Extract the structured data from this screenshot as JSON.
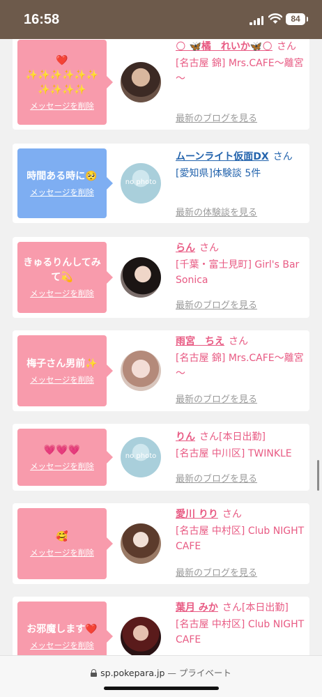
{
  "status_bar": {
    "time": "16:58",
    "battery": "84"
  },
  "cards": [
    {
      "bubble_text": "❤️\n✨✨✨✨✨✨\n✨✨✨✨",
      "bubble_color": "#f89bac",
      "delete_label": "メッセージを削除",
      "name": "🌕 🦋橘　れいか🦋🌕",
      "san": "さん",
      "extra": "",
      "location": "[名古屋 錦] Mrs.CAFE～離宮～",
      "link": "最新のブログを見る",
      "name_color": "#e85a83"
    },
    {
      "bubble_text": "時間ある時に🥺",
      "bubble_color": "#7eaef2",
      "delete_label": "メッセージを削除",
      "name": "ムーンライト仮面DX",
      "san": "さん",
      "extra": "",
      "location": "[愛知県]体験談 5件",
      "link": "最新の体験談を見る",
      "name_color": "#2464ad",
      "nophoto": "no photo"
    },
    {
      "bubble_text": "きゅるりんしてみて💫",
      "bubble_color": "#f89bac",
      "delete_label": "メッセージを削除",
      "name": "らん",
      "san": "さん",
      "extra": "",
      "location": "[千葉・富士見町] Girl's Bar Sonica",
      "link": "最新のブログを見る",
      "name_color": "#e85a83"
    },
    {
      "bubble_text": "梅子さん男前✨",
      "bubble_color": "#f89bac",
      "delete_label": "メッセージを削除",
      "name": "雨宮　ちえ",
      "san": "さん",
      "extra": "",
      "location": "[名古屋 錦] Mrs.CAFE～離宮～",
      "link": "最新のブログを見る",
      "name_color": "#e85a83"
    },
    {
      "bubble_text": "💗💗💗",
      "bubble_color": "#f89bac",
      "delete_label": "メッセージを削除",
      "name": "りん",
      "san": "さん",
      "extra": "[本日出勤]",
      "location": "[名古屋 中川区] TWINKLE",
      "link": "最新のブログを見る",
      "name_color": "#e85a83",
      "nophoto": "no photo"
    },
    {
      "bubble_text": "🥰",
      "bubble_color": "#f89bac",
      "delete_label": "メッセージを削除",
      "name": "愛川 りり",
      "san": "さん",
      "extra": "",
      "location": "[名古屋 中村区] Club NIGHT CAFE",
      "link": "最新のブログを見る",
      "name_color": "#e85a83"
    },
    {
      "bubble_text": "お邪魔します❤️",
      "bubble_color": "#f89bac",
      "delete_label": "メッセージを削除",
      "name": "葉月 みか",
      "san": "さん",
      "extra": "[本日出勤]",
      "location": "[名古屋 中村区] Club NIGHT CAFE",
      "link": "",
      "name_color": "#e85a83"
    }
  ],
  "bottom_bar": {
    "domain": "sp.pokepara.jp",
    "separator": "—",
    "private": "プライベート"
  }
}
